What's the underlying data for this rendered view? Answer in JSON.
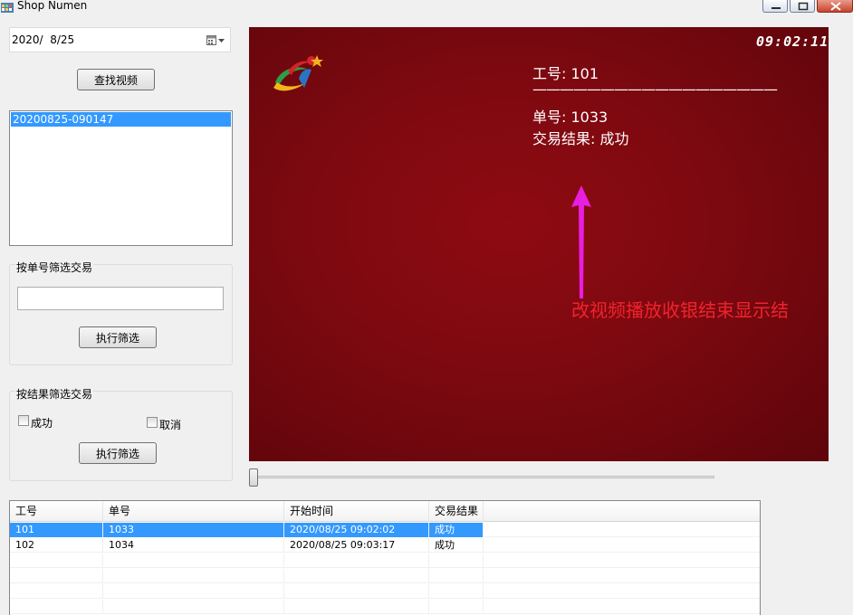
{
  "window": {
    "title": "Shop Numen"
  },
  "date_picker": {
    "value": "2020/  8/25",
    "icon": "calendar-dropdown-icon"
  },
  "search_button_label": "查找视频",
  "video_list": {
    "items": [
      "20200825-090147"
    ]
  },
  "order_filter": {
    "group_label": "按单号筛选交易",
    "input_value": "",
    "button_label": "执行筛选"
  },
  "result_filter": {
    "group_label": "按结果筛选交易",
    "options": [
      {
        "label": "成功",
        "checked": false
      },
      {
        "label": "取消",
        "checked": false
      }
    ],
    "button_label": "执行筛选"
  },
  "video": {
    "timestamp": "09:02:11",
    "osd_employee": "工号: 101",
    "osd_divider": "——————————————————",
    "osd_order": "单号: 1033",
    "osd_result": "交易结果: 成功",
    "annotation": "改视频播放收银结束显示结",
    "annotation_color": "#f0232d",
    "arrow_color": "#e81ee0"
  },
  "slider": {
    "position": 0
  },
  "table": {
    "columns": [
      "工号",
      "单号",
      "开始时间",
      "交易结果"
    ],
    "rows": [
      [
        "101",
        "1033",
        "2020/08/25 09:02:02",
        "成功"
      ],
      [
        "102",
        "1034",
        "2020/08/25 09:03:17",
        "成功"
      ]
    ],
    "selected_row": 0
  },
  "colors": {
    "selection": "#3399ff",
    "video_bg": "#7d0910"
  }
}
